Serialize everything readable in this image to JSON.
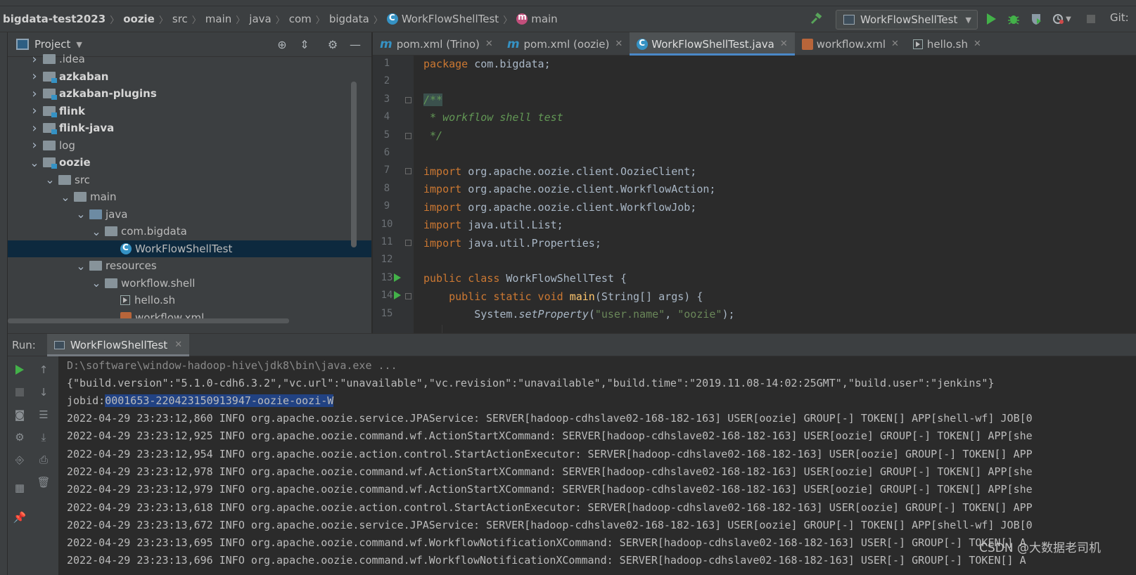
{
  "navbar": {
    "crumbs": [
      "bigdata-test2023",
      "oozie",
      "src",
      "main",
      "java",
      "com",
      "bigdata",
      "WorkFlowShellTest",
      "main"
    ],
    "run_config": "WorkFlowShellTest",
    "vcs_label": "Git:"
  },
  "project": {
    "title": "Project",
    "tree": [
      {
        "label": ".idea",
        "depth": 0,
        "arrow": "right",
        "type": "folder"
      },
      {
        "label": "azkaban",
        "depth": 0,
        "arrow": "right",
        "type": "module"
      },
      {
        "label": "azkaban-plugins",
        "depth": 0,
        "arrow": "right",
        "type": "module"
      },
      {
        "label": "flink",
        "depth": 0,
        "arrow": "right",
        "type": "module"
      },
      {
        "label": "flink-java",
        "depth": 0,
        "arrow": "right",
        "type": "module"
      },
      {
        "label": "log",
        "depth": 0,
        "arrow": "right",
        "type": "folder"
      },
      {
        "label": "oozie",
        "depth": 0,
        "arrow": "down",
        "type": "module"
      },
      {
        "label": "src",
        "depth": 1,
        "arrow": "down",
        "type": "folder"
      },
      {
        "label": "main",
        "depth": 2,
        "arrow": "down",
        "type": "folder"
      },
      {
        "label": "java",
        "depth": 3,
        "arrow": "down",
        "type": "src"
      },
      {
        "label": "com.bigdata",
        "depth": 4,
        "arrow": "down",
        "type": "pkg"
      },
      {
        "label": "WorkFlowShellTest",
        "depth": 5,
        "arrow": "",
        "type": "class"
      },
      {
        "label": "resources",
        "depth": 3,
        "arrow": "down",
        "type": "res"
      },
      {
        "label": "workflow.shell",
        "depth": 4,
        "arrow": "down",
        "type": "folder"
      },
      {
        "label": "hello.sh",
        "depth": 5,
        "arrow": "",
        "type": "sh"
      },
      {
        "label": "workflow.xml",
        "depth": 5,
        "arrow": "",
        "type": "xml"
      }
    ]
  },
  "editor": {
    "tabs": [
      {
        "label": "pom.xml (Trino)",
        "icon": "maven-icon",
        "active": false
      },
      {
        "label": "pom.xml (oozie)",
        "icon": "maven-icon",
        "active": false
      },
      {
        "label": "WorkFlowShellTest.java",
        "icon": "class-icon",
        "active": true
      },
      {
        "label": "workflow.xml",
        "icon": "xml-icon",
        "active": false
      },
      {
        "label": "hello.sh",
        "icon": "shell-icon",
        "active": false
      }
    ],
    "line_numbers": [
      "1",
      "2",
      "3",
      "4",
      "5",
      "6",
      "7",
      "8",
      "9",
      "10",
      "11",
      "12",
      "13",
      "14",
      "15"
    ],
    "code": {
      "l1_kw": "package",
      "l1_rest": " com.bigdata;",
      "l3": "/**",
      "l4": " * workflow shell test",
      "l5": " */",
      "l7_kw": "import",
      "l7_rest": " org.apache.oozie.client.OozieClient;",
      "l8_kw": "import",
      "l8_rest": " org.apache.oozie.client.WorkflowAction;",
      "l9_kw": "import",
      "l9_rest": " org.apache.oozie.client.WorkflowJob;",
      "l10_kw": "import",
      "l10_rest": " java.util.List;",
      "l11_kw": "import",
      "l11_rest": " java.util.Properties;",
      "l13_kw": "public class",
      "l13_rest": " WorkFlowShellTest {",
      "l14_kw": "    public static void",
      "l14_fn": " main",
      "l14_rest": "(String[] args) {",
      "l15_a": "        System.",
      "l15_m": "setProperty",
      "l15_b": "(",
      "l15_s1": "\"user.name\"",
      "l15_c": ", ",
      "l15_s2": "\"oozie\"",
      "l15_d": ");"
    }
  },
  "run": {
    "label": "Run:",
    "tab": "WorkFlowShellTest",
    "console": {
      "cmd": "D:\\software\\window-hadoop-hive\\jdk8\\bin\\java.exe ...",
      "build": "{\"build.version\":\"5.1.0-cdh6.3.2\",\"vc.url\":\"unavailable\",\"vc.revision\":\"unavailable\",\"build.time\":\"2019.11.08-14:02:25GMT\",\"build.user\":\"jenkins\"}",
      "jobid_label": "jobid:",
      "jobid_value": "0001653-220423150913947-oozie-oozi-W",
      "logs": [
        "2022-04-29 23:23:12,860 INFO org.apache.oozie.service.JPAService: SERVER[hadoop-cdhslave02-168-182-163] USER[oozie] GROUP[-] TOKEN[] APP[shell-wf] JOB[0",
        "2022-04-29 23:23:12,925 INFO org.apache.oozie.command.wf.ActionStartXCommand: SERVER[hadoop-cdhslave02-168-182-163] USER[oozie] GROUP[-] TOKEN[] APP[she",
        "2022-04-29 23:23:12,954 INFO org.apache.oozie.action.control.StartActionExecutor: SERVER[hadoop-cdhslave02-168-182-163] USER[oozie] GROUP[-] TOKEN[] APP",
        "2022-04-29 23:23:12,978 INFO org.apache.oozie.command.wf.ActionStartXCommand: SERVER[hadoop-cdhslave02-168-182-163] USER[oozie] GROUP[-] TOKEN[] APP[she",
        "2022-04-29 23:23:12,979 INFO org.apache.oozie.command.wf.ActionStartXCommand: SERVER[hadoop-cdhslave02-168-182-163] USER[oozie] GROUP[-] TOKEN[] APP[she",
        "2022-04-29 23:23:13,618 INFO org.apache.oozie.action.control.StartActionExecutor: SERVER[hadoop-cdhslave02-168-182-163] USER[oozie] GROUP[-] TOKEN[] APP",
        "2022-04-29 23:23:13,672 INFO org.apache.oozie.service.JPAService: SERVER[hadoop-cdhslave02-168-182-163] USER[oozie] GROUP[-] TOKEN[] APP[shell-wf] JOB[0",
        "2022-04-29 23:23:13,695 INFO org.apache.oozie.command.wf.WorkflowNotificationXCommand: SERVER[hadoop-cdhslave02-168-182-163] USER[-] GROUP[-] TOKEN[] A",
        "2022-04-29 23:23:13,696 INFO org.apache.oozie.command.wf.WorkflowNotificationXCommand: SERVER[hadoop-cdhslave02-168-182-163] USER[-] GROUP[-] TOKEN[] A"
      ]
    },
    "watermark": "CSDN @大数据老司机"
  },
  "colors": {
    "accent": "#4a88c7",
    "run_green": "#43b149",
    "keyword": "#cc7832",
    "comment": "#629755",
    "string": "#6a8759",
    "selection": "#214283"
  }
}
